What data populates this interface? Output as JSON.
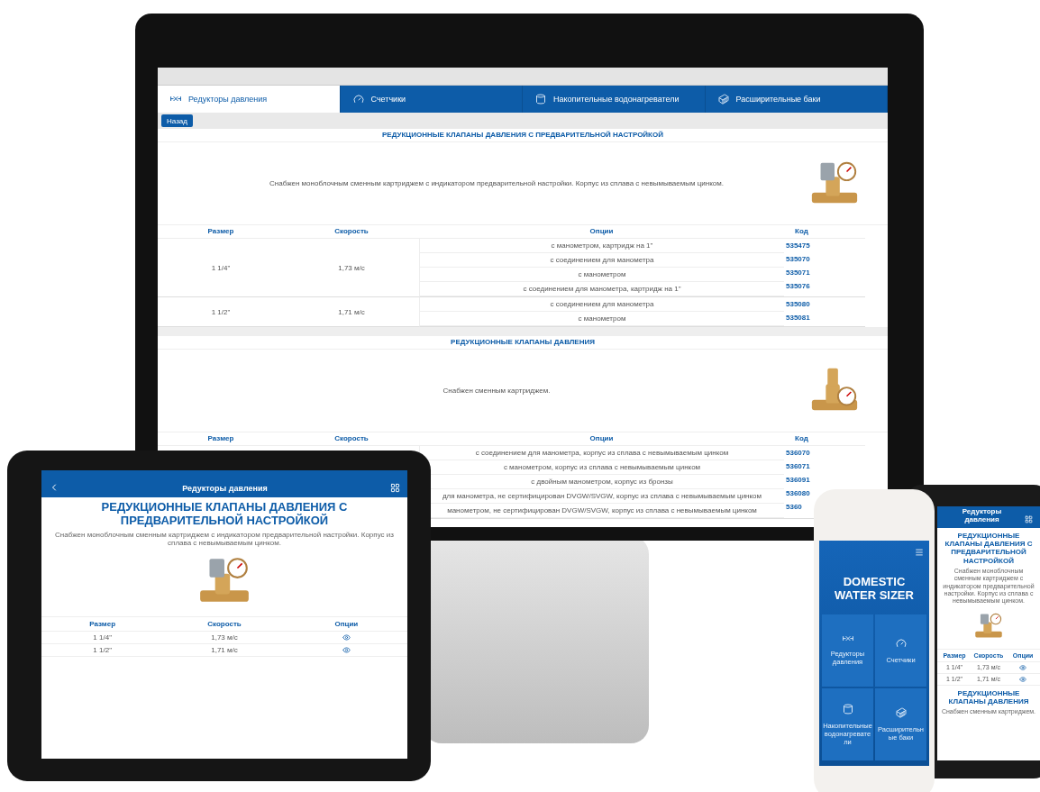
{
  "monitor": {
    "tabs": [
      {
        "label": "Редукторы давления",
        "selected": true
      },
      {
        "label": "Счетчики",
        "selected": false
      },
      {
        "label": "Накопительные водонагреватели",
        "selected": false
      },
      {
        "label": "Расширительные баки",
        "selected": false
      }
    ],
    "back_button": "Назад",
    "sections": [
      {
        "title": "РЕДУКЦИОННЫЕ КЛАПАНЫ ДАВЛЕНИЯ С ПРЕДВАРИТЕЛЬНОЙ НАСТРОЙКОЙ",
        "description": "Снабжен моноблочным сменным картриджем с индикатором предварительной настройки. Корпус из сплава с невымываемым цинком.",
        "columns": [
          "Размер",
          "Скорость",
          "Опции",
          "Код"
        ],
        "groups": [
          {
            "size": "1 1/4\"",
            "speed": "1,73 м/с",
            "options": [
              {
                "text": "с манометром, картридж на 1\"",
                "code": "535475"
              },
              {
                "text": "с соединением для манометра",
                "code": "535070"
              },
              {
                "text": "с манометром",
                "code": "535071"
              },
              {
                "text": "с соединением для манометра, картридж на 1\"",
                "code": "535076"
              }
            ]
          },
          {
            "size": "1 1/2\"",
            "speed": "1,71 м/с",
            "options": [
              {
                "text": "с соединением для манометра",
                "code": "535080"
              },
              {
                "text": "с манометром",
                "code": "535081"
              }
            ]
          }
        ]
      },
      {
        "title": "РЕДУКЦИОННЫЕ КЛАПАНЫ ДАВЛЕНИЯ",
        "description": "Снабжен сменным картриджем.",
        "columns": [
          "Размер",
          "Скорость",
          "Опции",
          "Код"
        ],
        "groups": [
          {
            "options": [
              {
                "text": "с соединением для манометра, корпус из сплава с невымываемым цинком",
                "code": "536070"
              },
              {
                "text": "с манометром, корпус из сплава с невымываемым цинком",
                "code": "536071"
              },
              {
                "text": "с двойным манометром, корпус из бронзы",
                "code": "536091"
              },
              {
                "text": "для манометра, не сертифицирован DVGW/SVGW, корпус из сплава с невымываемым цинком",
                "code": "536080"
              },
              {
                "text": "манометром, не сертифицирован DVGW/SVGW, корпус из сплава с невымываемым цинком",
                "code": "5360"
              }
            ]
          }
        ]
      }
    ]
  },
  "tablet": {
    "header": "Редукторы давления",
    "title": "РЕДУКЦИОННЫЕ КЛАПАНЫ ДАВЛЕНИЯ С ПРЕДВАРИТЕЛЬНОЙ НАСТРОЙКОЙ",
    "description": "Снабжен моноблочным сменным картриджем с индикатором предварительной настройки. Корпус из сплава с невымываемым цинком.",
    "columns": [
      "Размер",
      "Скорость",
      "Опции"
    ],
    "rows": [
      {
        "size": "1 1/4\"",
        "speed": "1,73 м/с"
      },
      {
        "size": "1 1/2\"",
        "speed": "1,71 м/с"
      }
    ]
  },
  "iphone": {
    "title": "DOMESTIC WATER SIZER",
    "tiles": [
      {
        "label": "Редукторы давления"
      },
      {
        "label": "Счетчики"
      },
      {
        "label": "Накопительные водонагреватели"
      },
      {
        "label": "Расширительные баки"
      }
    ]
  },
  "android": {
    "header": "Редукторы давления",
    "title": "РЕДУКЦИОННЫЕ КЛАПАНЫ ДАВЛЕНИЯ С ПРЕДВАРИТЕЛЬНОЙ НАСТРОЙКОЙ",
    "description": "Снабжен моноблочным сменным картриджем с индикатором предварительной настройки. Корпус из сплава с невымываемым цинком.",
    "columns": [
      "Размер",
      "Скорость",
      "Опции"
    ],
    "rows": [
      {
        "size": "1 1/4\"",
        "speed": "1,73 м/с"
      },
      {
        "size": "1 1/2\"",
        "speed": "1,71 м/с"
      }
    ],
    "next_title": "РЕДУКЦИОННЫЕ КЛАПАНЫ ДАВЛЕНИЯ",
    "next_description": "Снабжен сменным картриджем."
  }
}
